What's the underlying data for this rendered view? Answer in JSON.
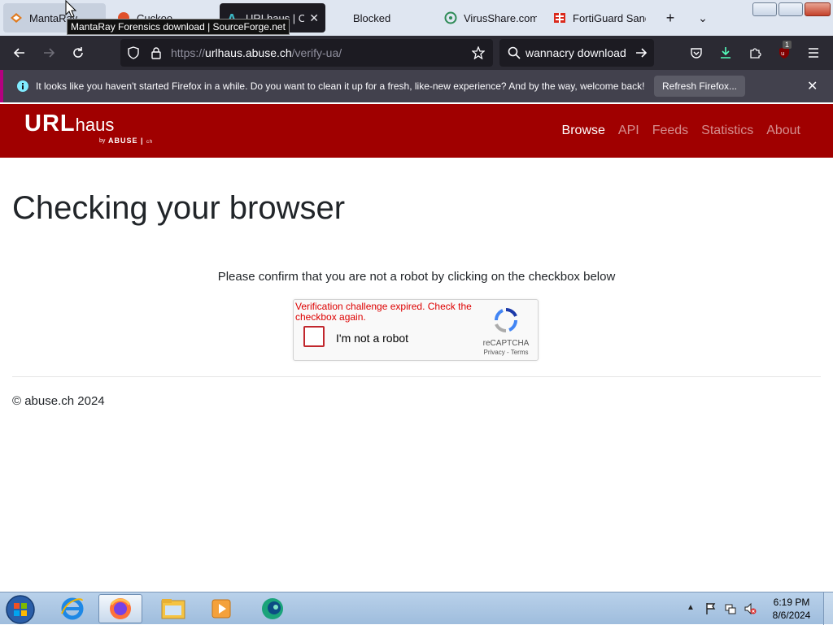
{
  "browser": {
    "tabs": [
      {
        "title": "MantaRay",
        "icon": "mantaray-favicon"
      },
      {
        "title": "Cuckoo...",
        "icon": "sourceforge-favicon"
      },
      {
        "title": "URLhaus | Che",
        "icon": "urlhaus-favicon"
      },
      {
        "title": "Blocked",
        "icon": "blocked-favicon"
      },
      {
        "title": "VirusShare.com",
        "icon": "biohazard-favicon"
      },
      {
        "title": "FortiGuard Sandb",
        "icon": "fortiguard-favicon"
      }
    ],
    "tab_tooltip": "MantaRay Forensics download | SourceForge.net",
    "url": {
      "scheme": "https://",
      "host": "urlhaus.abuse.ch",
      "path": "/verify-ua/"
    },
    "search_value": "wannacry download",
    "extension_badge": "1",
    "notification": {
      "text": "It looks like you haven't started Firefox in a while. Do you want to clean it up for a fresh, like-new experience? And by the way, welcome back!",
      "button": "Refresh Firefox..."
    },
    "colors": {
      "tab_active": "#1c1b22",
      "toolbar": "#2b2a33",
      "notification_accent": "#b5007f"
    }
  },
  "site": {
    "logo": {
      "main": "URL",
      "secondary": "haus",
      "by": "by",
      "brand": "ABUSE",
      "suffix": "ch"
    },
    "nav": [
      "Browse",
      "API",
      "Feeds",
      "Statistics",
      "About"
    ],
    "active_nav": "Browse",
    "header_color": "#a00000"
  },
  "page": {
    "title": "Checking your browser",
    "instruction": "Please confirm that you are not a robot by clicking on the checkbox below",
    "recaptcha": {
      "error": "Verification challenge expired. Check the checkbox again.",
      "label": "I'm not a robot",
      "brand": "reCAPTCHA",
      "terms": "Privacy - Terms"
    },
    "footer": "© abuse.ch 2024"
  },
  "taskbar": {
    "items": [
      "start-orb",
      "internet-explorer-icon",
      "firefox-icon",
      "file-explorer-icon",
      "media-player-icon",
      "app-icon"
    ],
    "active_item": "firefox-icon",
    "clock": {
      "time": "6:19 PM",
      "date": "8/6/2024"
    }
  }
}
